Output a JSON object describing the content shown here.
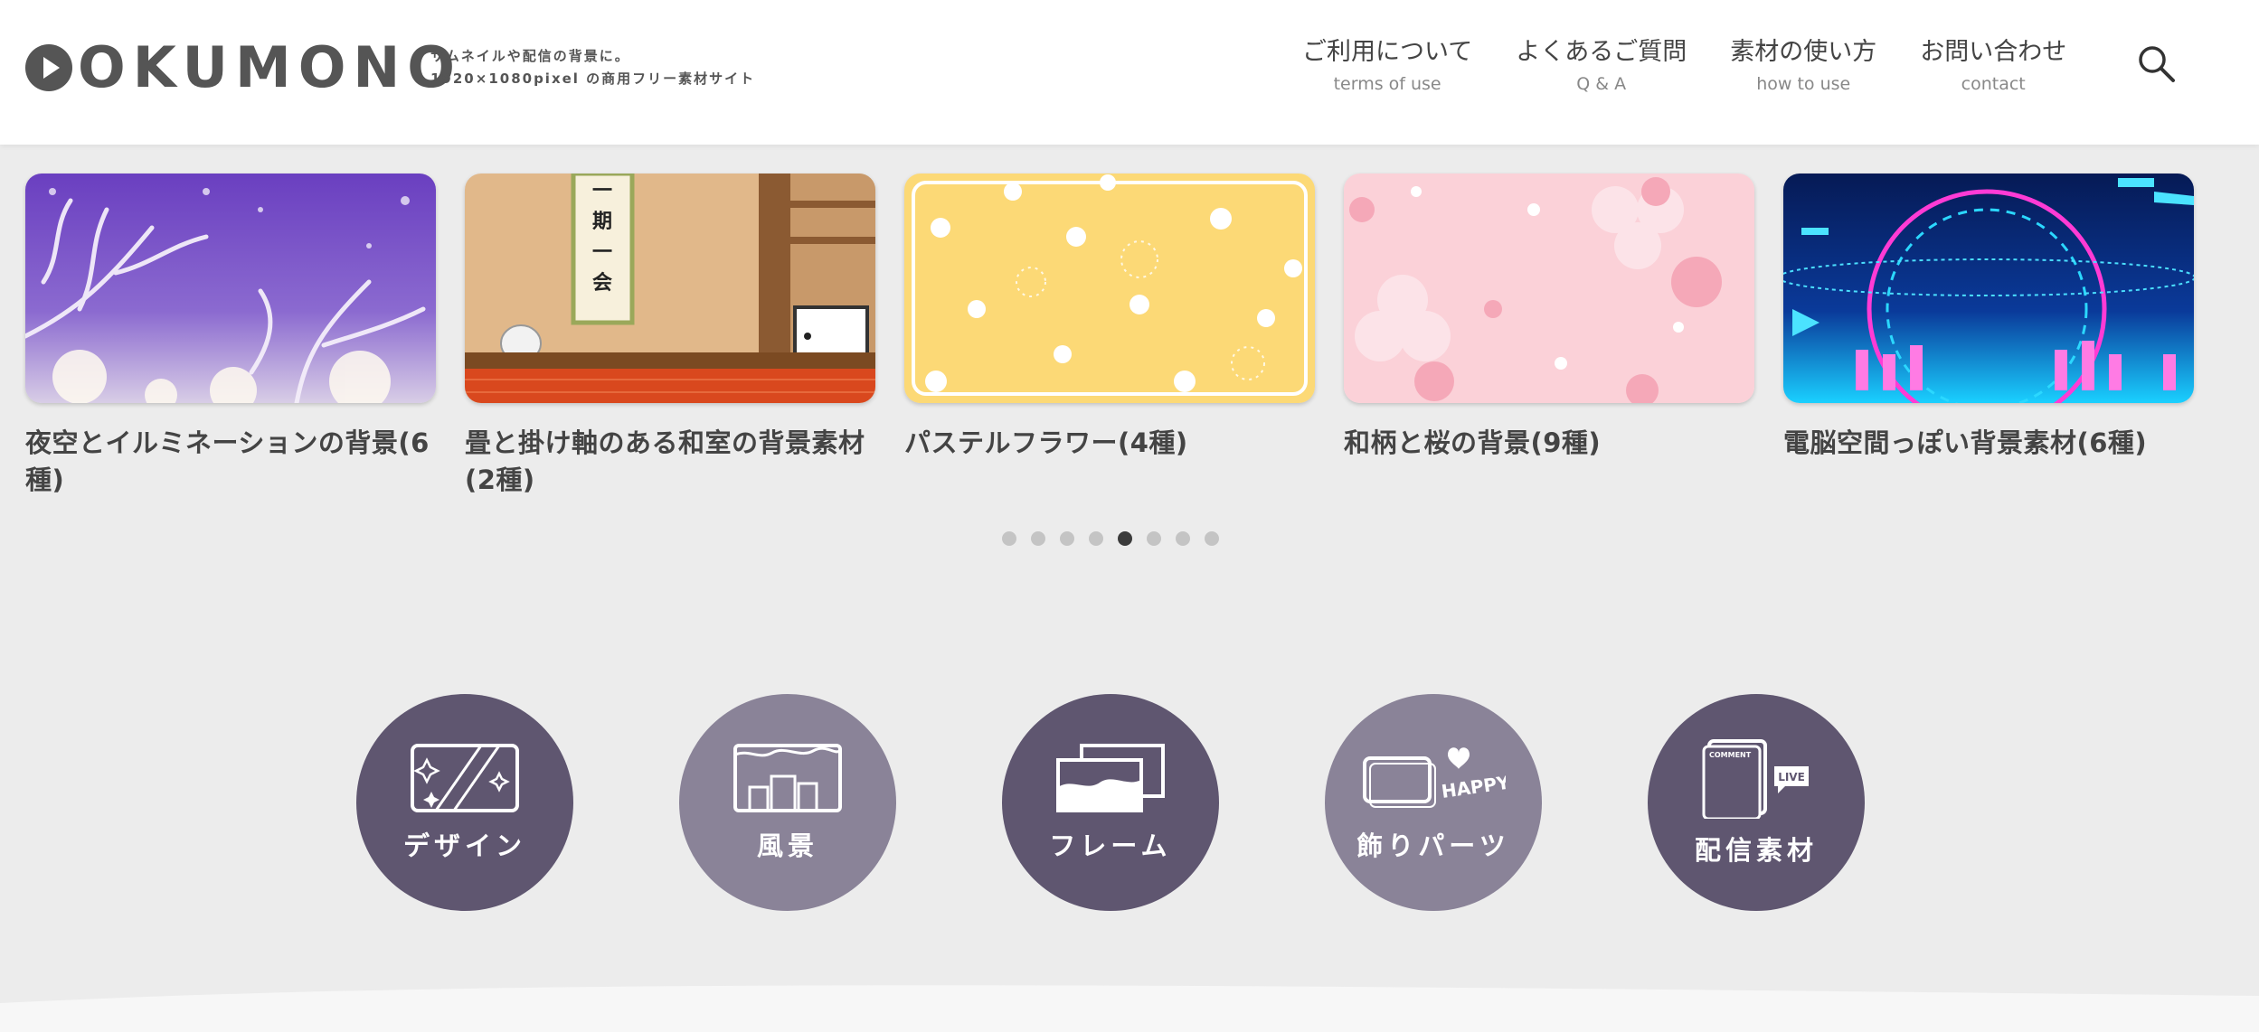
{
  "logo": {
    "text": "OKUMONO",
    "tagline_1": "サムネイルや配信の背景に。",
    "tagline_2": "1920×1080pixel の商用フリー素材サイト"
  },
  "nav": [
    {
      "label": "ご利用について",
      "sub": "terms of use"
    },
    {
      "label": "よくあるご質問",
      "sub": "Q & A"
    },
    {
      "label": "素材の使い方",
      "sub": "how to use"
    },
    {
      "label": "お問い合わせ",
      "sub": "contact"
    }
  ],
  "search": {
    "icon": "search-icon"
  },
  "carousel": {
    "cards": [
      {
        "title": "夜空とイルミネーションの背景(6種)"
      },
      {
        "title": "畳と掛け軸のある和室の背景素材(2種)"
      },
      {
        "title": "パステルフラワー(4種)"
      },
      {
        "title": "和柄と桜の背景(9種)"
      },
      {
        "title": "電脳空間っぽい背景素材(6種)"
      }
    ],
    "dots_count": 8,
    "active_dot": 5
  },
  "categories": [
    {
      "label": "デザイン",
      "icon": "design-icon"
    },
    {
      "label": "風景",
      "icon": "landscape-icon"
    },
    {
      "label": "フレーム",
      "icon": "frame-icon"
    },
    {
      "label": "飾りパーツ",
      "icon": "decoration-icon"
    },
    {
      "label": "配信素材",
      "icon": "streaming-icon"
    }
  ],
  "thumb_text": {
    "scroll": "一期一会",
    "happy": "HAPPY",
    "comment": "COMMENT",
    "live": "LIVE"
  },
  "colors": {
    "header_bg": "#ffffff",
    "page_bg": "#ececec",
    "category_dark": "#5f5670",
    "category_light": "#8a8398",
    "dot_active": "#3b3b3b",
    "dot_inactive": "#c4c4c4"
  }
}
